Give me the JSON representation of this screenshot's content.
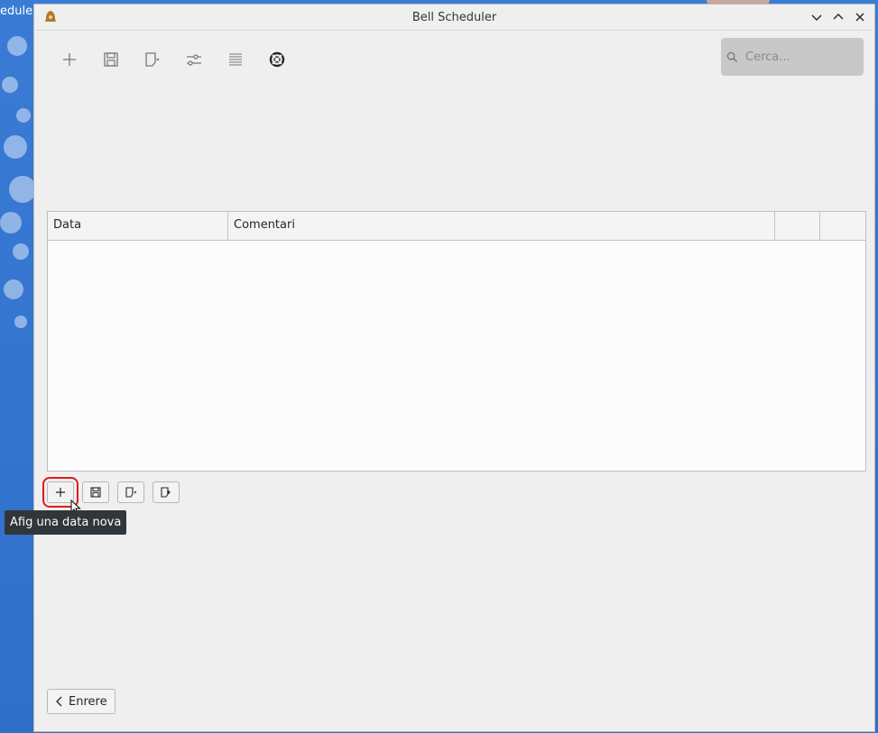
{
  "desktop": {
    "partial_label": "eduler"
  },
  "window": {
    "title": "Bell Scheduler",
    "controls": [
      "chevron-down-icon",
      "chevron-up-icon",
      "close-icon"
    ]
  },
  "toolbar": {
    "buttons": [
      "plus-icon",
      "save-icon",
      "export-icon",
      "settings-sliders-icon",
      "list-icon",
      "help-lifebuoy-icon"
    ]
  },
  "search": {
    "placeholder": "Cerca..."
  },
  "table": {
    "headers": [
      "Data",
      "Comentari",
      "",
      ""
    ],
    "rows": []
  },
  "bottom_buttons": [
    "add-icon",
    "save-icon",
    "export-icon",
    "import-icon"
  ],
  "tooltip": {
    "text": "Afig una data nova"
  },
  "back_button": {
    "label": "Enrere"
  },
  "colors": {
    "highlight": "#e01b1b",
    "tooltip_bg": "#31363b",
    "window_bg": "#efefef",
    "search_bg": "#c8c8c8"
  }
}
